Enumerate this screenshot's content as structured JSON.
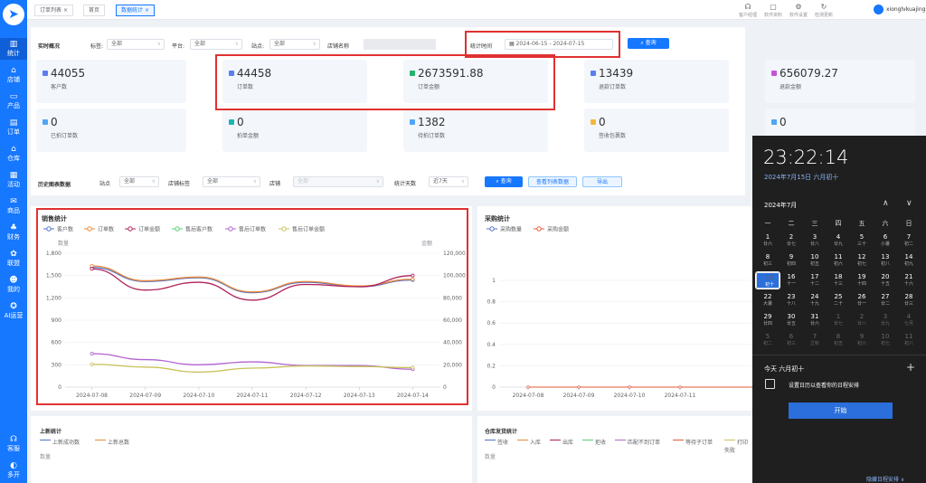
{
  "sidebar": {
    "items": [
      {
        "icon": "chart-icon",
        "glyph": "▥",
        "label": "统计"
      },
      {
        "icon": "store-icon",
        "glyph": "⌂",
        "label": "店铺"
      },
      {
        "icon": "product-icon",
        "glyph": "▭",
        "label": "产品"
      },
      {
        "icon": "order-icon",
        "glyph": "▤",
        "label": "订单"
      },
      {
        "icon": "warehouse-icon",
        "glyph": "⌂",
        "label": "仓库"
      },
      {
        "icon": "activity-icon",
        "glyph": "▦",
        "label": "活动"
      },
      {
        "icon": "goods-icon",
        "glyph": "✉",
        "label": "商品"
      },
      {
        "icon": "finance-icon",
        "glyph": "♣",
        "label": "财务"
      },
      {
        "icon": "alliance-icon",
        "glyph": "✿",
        "label": "联盟"
      },
      {
        "icon": "me-icon",
        "glyph": "☻",
        "label": "我的"
      },
      {
        "icon": "ai-icon",
        "glyph": "✪",
        "label": "AI运营"
      }
    ],
    "service_label": "客服",
    "multi_label": "多开"
  },
  "tabs": [
    {
      "label": "订单列表",
      "close": "×"
    },
    {
      "label": "首页",
      "close": ""
    },
    {
      "label": "数据统计",
      "close": "×"
    }
  ],
  "toolbar": [
    {
      "icon": "customer-service-icon",
      "glyph": "☊",
      "label": "客户经理"
    },
    {
      "icon": "software-doc-icon",
      "glyph": "▢",
      "label": "软件资料"
    },
    {
      "icon": "software-settings-icon",
      "glyph": "⚙",
      "label": "软件设置"
    },
    {
      "icon": "refresh-icon",
      "glyph": "↻",
      "label": "检测更新"
    }
  ],
  "user": {
    "name": "xionglvkuajing"
  },
  "realtime": {
    "title": "实时概况",
    "tag_label": "标签:",
    "tag_value": "全部",
    "platform_label": "平台:",
    "platform_value": "全部",
    "site_label": "站点:",
    "site_value": "全部",
    "shop_name_label": "店铺名称",
    "time_label": "统计时间",
    "date_start": "2024-06-15",
    "date_sep": "-",
    "date_end": "2024-07-15",
    "query_label": "查询"
  },
  "cards": [
    {
      "value": "44055",
      "label": "客户数",
      "color": "#5b7ff0"
    },
    {
      "value": "44458",
      "label": "订单数",
      "color": "#5b7ff0"
    },
    {
      "value": "2673591.88",
      "label": "订单金额",
      "color": "#23b36b"
    },
    {
      "value": "13439",
      "label": "退款订单数",
      "color": "#5b7ff0"
    },
    {
      "value": "656079.27",
      "label": "退款金额",
      "color": "#c655d6"
    },
    {
      "value": "0",
      "label": "已拍订单数",
      "color": "#4ea6f5"
    },
    {
      "value": "0",
      "label": "拍单金额",
      "color": "#1bb5b5"
    },
    {
      "value": "1382",
      "label": "待拍订单数",
      "color": "#4ea6f5"
    },
    {
      "value": "0",
      "label": "签收包裹数",
      "color": "#f5b73b"
    },
    {
      "value": "0",
      "label": "",
      "color": "#4ea6f5"
    }
  ],
  "history": {
    "title": "历史图表数据",
    "site_label": "站点",
    "site_value": "全部",
    "shoptag_label": "店铺标签",
    "shoptag_value": "全部",
    "shop_label": "店铺",
    "shop_value": "全部",
    "days_label": "统计天数",
    "days_value": "近7天",
    "query_label": "查询",
    "list_label": "查看列表数据",
    "export_label": "导出"
  },
  "sales_chart": {
    "title": "销售统计",
    "left_unit": "数量",
    "right_unit": "金额",
    "categories": [
      "2024-07-08",
      "2024-07-09",
      "2024-07-10",
      "2024-07-11",
      "2024-07-12",
      "2024-07-13",
      "2024-07-14"
    ],
    "y_left_ticks": [
      "0",
      "300",
      "600",
      "900",
      "1,200",
      "1,500",
      "1,800"
    ],
    "y_right_ticks": [
      "0",
      "20,000",
      "40,000",
      "60,000",
      "80,000",
      "100,000",
      "120,000"
    ],
    "ylim_left": [
      0,
      1800
    ],
    "ylim_right": [
      0,
      120000
    ],
    "series": [
      {
        "name": "客户数",
        "color": "#5470c6",
        "values": [
          1610,
          1420,
          1470,
          1270,
          1410,
          1350,
          1440
        ],
        "axis": "left"
      },
      {
        "name": "订单数",
        "color": "#e98a3a",
        "values": [
          1630,
          1430,
          1480,
          1280,
          1420,
          1360,
          1450
        ],
        "axis": "left"
      },
      {
        "name": "订单金额",
        "color": "#b0215a",
        "values": [
          106000,
          87000,
          94000,
          78000,
          92000,
          90000,
          100000
        ],
        "axis": "right"
      },
      {
        "name": "售后客户数",
        "color": "#5bd072",
        "values": [
          null,
          null,
          null,
          null,
          null,
          null,
          null
        ],
        "axis": "left"
      },
      {
        "name": "售后订单数",
        "color": "#b263cf",
        "values": [
          450,
          370,
          300,
          340,
          290,
          290,
          240
        ],
        "axis": "left"
      },
      {
        "name": "售后订单金额",
        "color": "#c8c25a",
        "values": [
          20500,
          18000,
          13500,
          17000,
          19000,
          18500,
          17500
        ],
        "axis": "right"
      }
    ]
  },
  "purchase_chart": {
    "title": "采购统计",
    "categories": [
      "2024-07-08",
      "2024-07-09",
      "2024-07-10",
      "2024-07-11"
    ],
    "y_ticks": [
      "0",
      "0.2",
      "0.4",
      "0.6",
      "0.8",
      "1"
    ],
    "ylim": [
      0,
      1
    ],
    "series": [
      {
        "name": "采购数量",
        "color": "#5470c6",
        "values": [
          0,
          0,
          0,
          0
        ]
      },
      {
        "name": "采购金额",
        "color": "#e05a3a",
        "values": [
          0,
          0,
          0,
          0
        ]
      }
    ]
  },
  "newlisting": {
    "title": "上新统计",
    "unit": "数量",
    "legend": [
      {
        "name": "上新成功数",
        "color": "#5470c6"
      },
      {
        "name": "上新总数",
        "color": "#e98a3a"
      }
    ]
  },
  "warehouse": {
    "title": "仓库发货统计",
    "unit": "数量",
    "legend": [
      {
        "name": "签收",
        "color": "#5470c6"
      },
      {
        "name": "入库",
        "color": "#e98a3a"
      },
      {
        "name": "出库",
        "color": "#b0215a"
      },
      {
        "name": "拒收",
        "color": "#5bd072"
      },
      {
        "name": "匹配不到订单",
        "color": "#b263cf"
      },
      {
        "name": "等待子订单",
        "color": "#e05a3a"
      },
      {
        "name": "打印失败",
        "color": "#c8c25a"
      }
    ]
  },
  "calendar": {
    "time": "23:22:14",
    "date": "2024年7月15日 六月初十",
    "month": "2024年7月",
    "weekdays": [
      "一",
      "二",
      "三",
      "四",
      "五",
      "六",
      "日"
    ],
    "days": [
      {
        "d": "1",
        "l": "廿六"
      },
      {
        "d": "2",
        "l": "廿七"
      },
      {
        "d": "3",
        "l": "廿八"
      },
      {
        "d": "4",
        "l": "廿九"
      },
      {
        "d": "5",
        "l": "三十"
      },
      {
        "d": "6",
        "l": "小暑"
      },
      {
        "d": "7",
        "l": "初二"
      },
      {
        "d": "8",
        "l": "初三"
      },
      {
        "d": "9",
        "l": "初四"
      },
      {
        "d": "10",
        "l": "初五"
      },
      {
        "d": "11",
        "l": "初六"
      },
      {
        "d": "12",
        "l": "初七"
      },
      {
        "d": "13",
        "l": "初八"
      },
      {
        "d": "14",
        "l": "初九"
      },
      {
        "d": "15",
        "l": "初十"
      },
      {
        "d": "16",
        "l": "十一"
      },
      {
        "d": "17",
        "l": "十二"
      },
      {
        "d": "18",
        "l": "十三"
      },
      {
        "d": "19",
        "l": "十四"
      },
      {
        "d": "20",
        "l": "十五"
      },
      {
        "d": "21",
        "l": "十六"
      },
      {
        "d": "22",
        "l": "大暑"
      },
      {
        "d": "23",
        "l": "十八"
      },
      {
        "d": "24",
        "l": "十九"
      },
      {
        "d": "25",
        "l": "二十"
      },
      {
        "d": "26",
        "l": "廿一"
      },
      {
        "d": "27",
        "l": "廿二"
      },
      {
        "d": "28",
        "l": "廿三"
      },
      {
        "d": "29",
        "l": "廿四"
      },
      {
        "d": "30",
        "l": "廿五"
      },
      {
        "d": "31",
        "l": "廿六"
      },
      {
        "d": "1",
        "l": "廿七"
      },
      {
        "d": "2",
        "l": "廿八"
      },
      {
        "d": "3",
        "l": "廿九"
      },
      {
        "d": "4",
        "l": "七月"
      },
      {
        "d": "5",
        "l": "初二"
      },
      {
        "d": "6",
        "l": "初三"
      },
      {
        "d": "7",
        "l": "立秋"
      },
      {
        "d": "8",
        "l": "初五"
      },
      {
        "d": "9",
        "l": "初六"
      },
      {
        "d": "10",
        "l": "初七"
      },
      {
        "d": "11",
        "l": "初八"
      }
    ],
    "selected": "15",
    "today_label": "今天 六月初十",
    "event_text": "设置日历以查看你的日程安排",
    "start_label": "开始",
    "hide_label": "隐藏日程安排 ∨"
  },
  "chart_data": [
    {
      "type": "line",
      "title": "销售统计",
      "x": [
        "2024-07-08",
        "2024-07-09",
        "2024-07-10",
        "2024-07-11",
        "2024-07-12",
        "2024-07-13",
        "2024-07-14"
      ],
      "ylabel": "数量",
      "y2label": "金额",
      "ylim": [
        0,
        1800
      ],
      "y2lim": [
        0,
        120000
      ],
      "series": [
        {
          "name": "客户数",
          "values": [
            1610,
            1420,
            1470,
            1270,
            1410,
            1350,
            1440
          ]
        },
        {
          "name": "订单数",
          "values": [
            1630,
            1430,
            1480,
            1280,
            1420,
            1360,
            1450
          ]
        },
        {
          "name": "订单金额",
          "axis": "right",
          "values": [
            106000,
            87000,
            94000,
            78000,
            92000,
            90000,
            100000
          ]
        },
        {
          "name": "售后客户数",
          "values": []
        },
        {
          "name": "售后订单数",
          "values": [
            450,
            370,
            300,
            340,
            290,
            290,
            240
          ]
        },
        {
          "name": "售后订单金额",
          "axis": "right",
          "values": [
            20500,
            18000,
            13500,
            17000,
            19000,
            18500,
            17500
          ]
        }
      ]
    },
    {
      "type": "line",
      "title": "采购统计",
      "x": [
        "2024-07-08",
        "2024-07-09",
        "2024-07-10",
        "2024-07-11"
      ],
      "ylim": [
        0,
        1
      ],
      "series": [
        {
          "name": "采购数量",
          "values": [
            0,
            0,
            0,
            0
          ]
        },
        {
          "name": "采购金额",
          "values": [
            0,
            0,
            0,
            0
          ]
        }
      ]
    }
  ]
}
